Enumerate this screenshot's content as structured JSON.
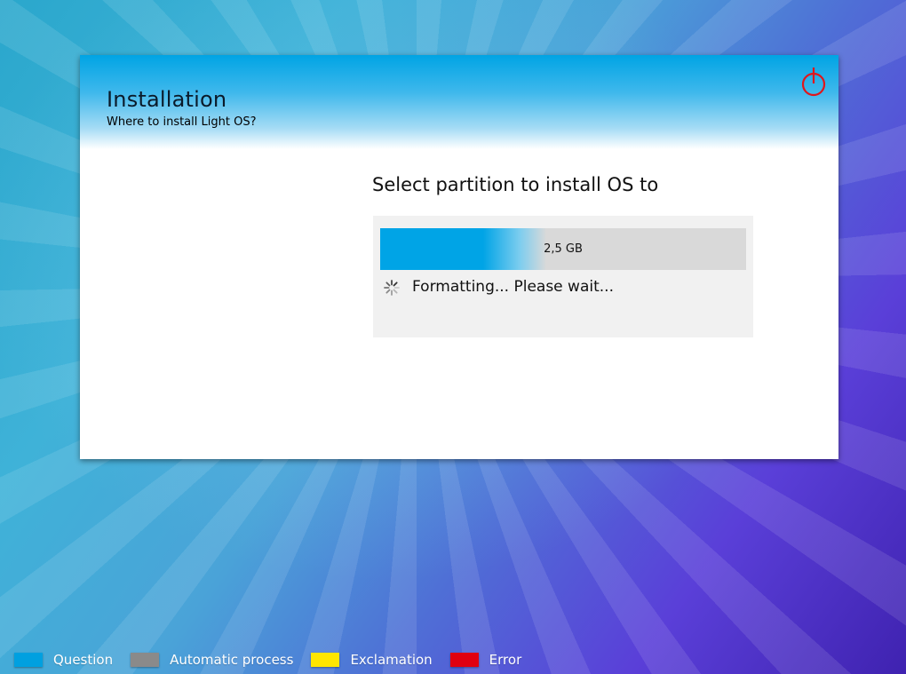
{
  "window": {
    "title": "Installation",
    "subtitle": "Where to install Light OS?",
    "power_icon": "power-icon",
    "power_color": "#e0161c"
  },
  "main": {
    "heading": "Select partition to install OS to",
    "partition": {
      "size_label": "2,5 GB",
      "fill_fraction": 0.34,
      "fill_color": "#00a4e6"
    },
    "status": {
      "icon": "spinner-icon",
      "text": "Formatting... Please wait..."
    }
  },
  "legend": [
    {
      "label": "Question",
      "color": "#00a0e0"
    },
    {
      "label": "Automatic process",
      "color": "#8a8a8a"
    },
    {
      "label": "Exclamation",
      "color": "#ffe600"
    },
    {
      "label": "Error",
      "color": "#e00010"
    }
  ]
}
